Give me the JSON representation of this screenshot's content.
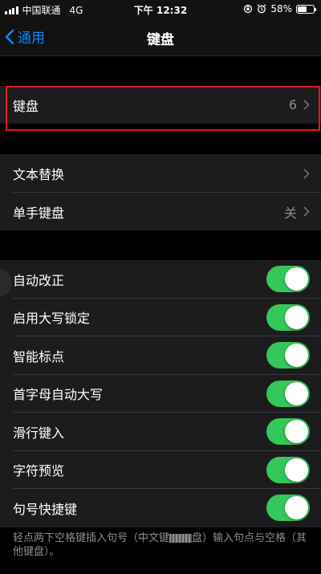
{
  "status_bar": {
    "carrier": "中国联通",
    "network": "4G",
    "time": "下午 12:32",
    "battery": "58%",
    "battery_level": 0.58
  },
  "nav": {
    "back_label": "通用",
    "title": "键盘"
  },
  "keyboards_row": {
    "label": "键盘",
    "value": "6"
  },
  "group2": [
    {
      "label": "文本替换",
      "value": ""
    },
    {
      "label": "单手键盘",
      "value": "关"
    }
  ],
  "toggles": [
    {
      "label": "自动改正",
      "on": true
    },
    {
      "label": "启用大写锁定",
      "on": true
    },
    {
      "label": "智能标点",
      "on": true
    },
    {
      "label": "首字母自动大写",
      "on": true
    },
    {
      "label": "滑行键入",
      "on": true
    },
    {
      "label": "字符预览",
      "on": true
    },
    {
      "label": "句号快捷键",
      "on": true
    }
  ],
  "footer": {
    "part1": "轻点两下空格键插入句号（中文键",
    "part2": "盘）输入句点与空格（其他键盘）。"
  },
  "colors": {
    "accent": "#0a84ff",
    "toggle_on": "#34c759",
    "highlight": "#e0191b"
  }
}
